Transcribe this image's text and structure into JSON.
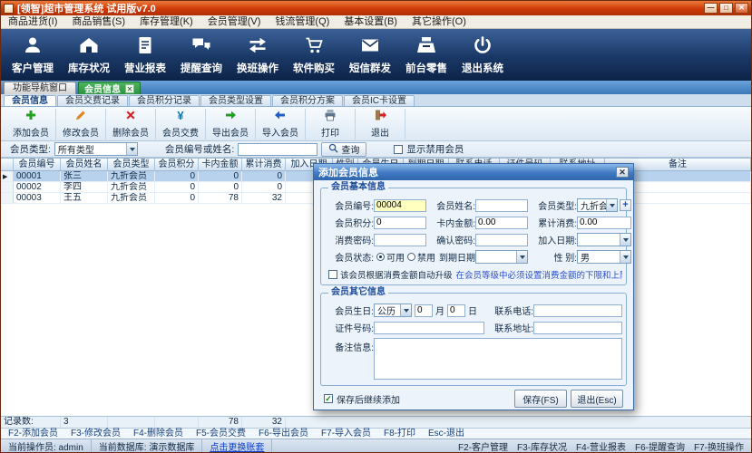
{
  "window": {
    "title": "[领智]超市管理系统 试用版v7.0",
    "controls": {
      "minimize": "—",
      "maximize": "□",
      "close": "✕"
    }
  },
  "menu": {
    "items": [
      "商品进货(I)",
      "商品销售(S)",
      "库存管理(K)",
      "会员管理(V)",
      "钱流管理(Q)",
      "基本设置(B)",
      "其它操作(O)"
    ]
  },
  "toolbar": {
    "items": [
      {
        "label": "客户管理",
        "icon": "customer-icon"
      },
      {
        "label": "库存状况",
        "icon": "warehouse-icon"
      },
      {
        "label": "营业报表",
        "icon": "report-icon"
      },
      {
        "label": "提醒查询",
        "icon": "reminder-icon"
      },
      {
        "label": "换班操作",
        "icon": "shift-swap-icon"
      },
      {
        "label": "软件购买",
        "icon": "cart-icon"
      },
      {
        "label": "短信群发",
        "icon": "sms-icon"
      },
      {
        "label": "前台零售",
        "icon": "register-icon"
      },
      {
        "label": "退出系统",
        "icon": "power-icon"
      }
    ]
  },
  "tabstrip": {
    "nav": "功能导航窗口",
    "active": "会员信息",
    "close": "✕"
  },
  "subtabs": {
    "items": [
      "会员信息",
      "会员交费记录",
      "会员积分记录",
      "会员类型设置",
      "会员积分方案",
      "会员IC卡设置"
    ]
  },
  "actions": {
    "items": [
      {
        "label": "添加会员",
        "icon": "add-icon"
      },
      {
        "label": "修改会员",
        "icon": "edit-icon"
      },
      {
        "label": "删除会员",
        "icon": "delete-icon"
      },
      {
        "label": "会员交费",
        "icon": "yuan-icon"
      },
      {
        "label": "导出会员",
        "icon": "export-icon"
      },
      {
        "label": "导入会员",
        "icon": "import-icon"
      },
      {
        "label": "打印",
        "icon": "print-icon"
      },
      {
        "label": "退出",
        "icon": "exit-icon"
      }
    ]
  },
  "filter": {
    "type_label": "会员类型:",
    "type_value": "所有类型",
    "keyword_label": "会员编号或姓名:",
    "keyword_value": "",
    "search_label": "查询",
    "show_disabled_label": "显示禁用会员"
  },
  "grid": {
    "columns": [
      "会员编号",
      "会员姓名",
      "会员类型",
      "会员积分",
      "卡内金额",
      "累计消费",
      "加入日期",
      "性别",
      "会员生日",
      "到期日期",
      "联系电话",
      "证件号码",
      "联系地址",
      "备注"
    ],
    "rows": [
      [
        "00001",
        "张三",
        "九折会员",
        "0",
        "0",
        "0",
        "",
        "",
        "",
        "",
        "",
        "",
        "",
        ""
      ],
      [
        "00002",
        "李四",
        "九折会员",
        "0",
        "0",
        "0",
        "",
        "",
        "",
        "",
        "",
        "",
        "",
        ""
      ],
      [
        "00003",
        "王五",
        "九折会员",
        "0",
        "78",
        "32",
        "",
        "",
        "",
        "",
        "",
        "",
        "",
        ""
      ]
    ],
    "footer": {
      "label": "记录数:",
      "count": "3",
      "sum_card": "78",
      "sum_consume": "32"
    }
  },
  "hotkeys": {
    "items": [
      "F2-添加会员",
      "F3-修改会员",
      "F4-删除会员",
      "F5-会员交费",
      "F6-导出会员",
      "F7-导入会员",
      "F8-打印",
      "Esc-退出"
    ]
  },
  "statusbar": {
    "operator": "当前操作员: admin",
    "database": "当前数据库: 演示数据库",
    "switch_link": "点击更换账套",
    "hotkeys": [
      "F2-客户管理",
      "F3-库存状况",
      "F4-营业报表",
      "F6-提醒查询",
      "F7-换班操作"
    ]
  },
  "dialog": {
    "title": "添加会员信息",
    "close": "✕",
    "basic": {
      "title": "会员基本信息",
      "no_label": "会员编号:",
      "no_value": "00004",
      "name_label": "会员姓名:",
      "name_value": "",
      "type_label": "会员类型:",
      "type_value": "九折会员",
      "add_type_label": "+",
      "points_label": "会员积分:",
      "points_value": "0",
      "card_label": "卡内金额:",
      "card_value": "0.00",
      "consume_label": "累计消费:",
      "consume_value": "0.00",
      "pwd_label": "消费密码:",
      "pwd_value": "",
      "pwd2_label": "确认密码:",
      "pwd2_value": "",
      "join_label": "加入日期:",
      "join_value": "",
      "status_label": "会员状态:",
      "status_on": "可用",
      "status_off": "禁用",
      "expire_label": "到期日期",
      "expire_value": "",
      "gender_label": "性 别:",
      "gender_value": "男",
      "upgrade_label": "该会员根据消费金额自动升级",
      "upgrade_note": "在会员等级中必须设置消费金额的下限和上限。"
    },
    "other": {
      "title": "会员其它信息",
      "birthday_label": "会员生日:",
      "calendar_value": "公历",
      "month_value": "0",
      "month_suffix": "月",
      "day_value": "0",
      "day_suffix": "日",
      "phone_label": "联系电话:",
      "id_label": "证件号码:",
      "addr_label": "联系地址:",
      "remark_label": "备注信息:"
    },
    "continue_label": "保存后继续添加",
    "save_label": "保存(FS)",
    "exit_label": "退出(Esc)"
  }
}
